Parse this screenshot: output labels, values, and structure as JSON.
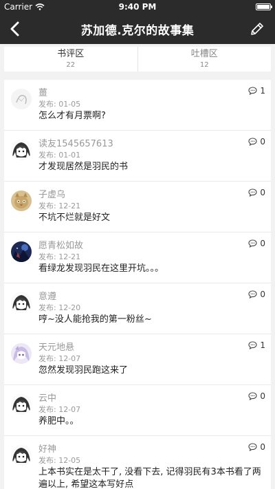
{
  "status_bar": {
    "carrier": "Carrier",
    "time": "9:40 PM"
  },
  "nav": {
    "title": "苏加德.克尔的故事集"
  },
  "tabs": [
    {
      "label": "书评区",
      "count": "22"
    },
    {
      "label": "吐槽区",
      "count": "12"
    }
  ],
  "comments": [
    {
      "user": "薑",
      "published": "发布: 01-05",
      "text": "怎么才有月票啊?",
      "replies": "1",
      "avatar": "ink-sketch"
    },
    {
      "user": "读友1545657613",
      "published": "发布: 01-01",
      "text": "才发现居然是羽民的书",
      "replies": "0",
      "avatar": "anime-white-hair"
    },
    {
      "user": "子虚乌",
      "published": "发布: 12-21",
      "text": "不坑不烂就是好文",
      "replies": "0",
      "avatar": "cat"
    },
    {
      "user": "愿青松如故",
      "published": "发布: 12-21",
      "text": "看绿龙发现羽民在这里开坑。。。",
      "replies": "0",
      "avatar": "dark-scene"
    },
    {
      "user": "意遵",
      "published": "发布: 12-20",
      "text": "哼~没人能抢我的第一粉丝~",
      "replies": "0",
      "avatar": "anime-white-hair"
    },
    {
      "user": "天元地悬",
      "published": "发布: 12-07",
      "text": "忽然发现羽民跑这来了",
      "replies": "1",
      "avatar": "anime-purple"
    },
    {
      "user": "云中",
      "published": "发布: 12-07",
      "text": "养肥中。。",
      "replies": "0",
      "avatar": "anime-white-hair"
    },
    {
      "user": "好神",
      "published": "发布: 12-05",
      "text": "上本书实在是太干了, 没看下去, 记得羽民有3本书看了两遍以上, 希望这本写好点",
      "replies": "0",
      "avatar": "anime-white-hair"
    }
  ]
}
